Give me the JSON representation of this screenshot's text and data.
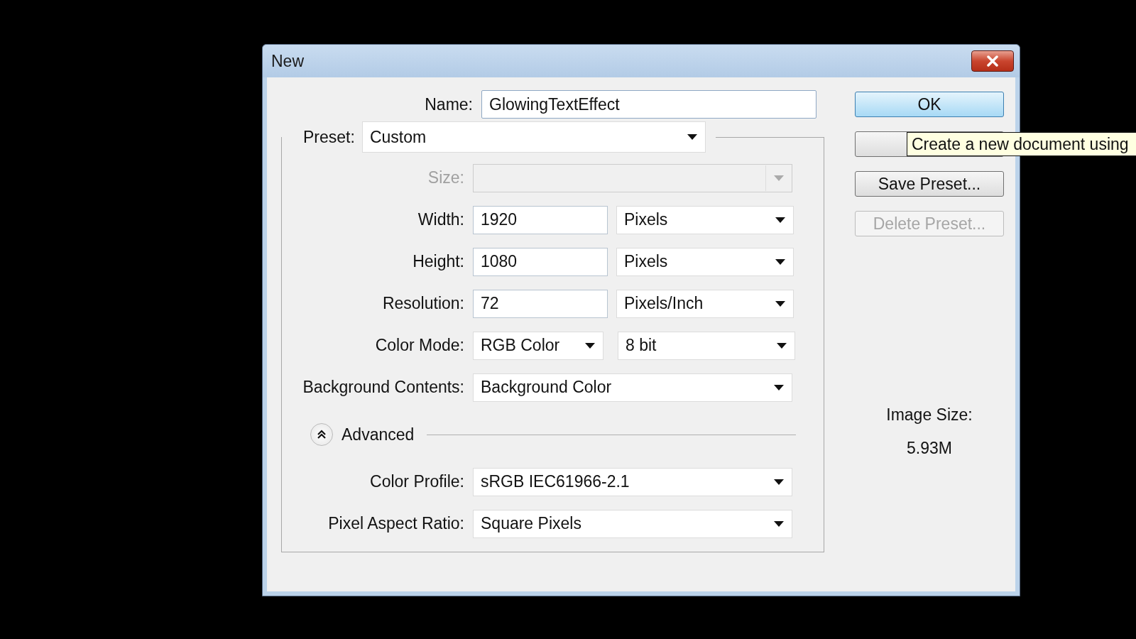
{
  "window": {
    "title": "New"
  },
  "name_field": {
    "label": "Name:",
    "value": "GlowingTextEffect"
  },
  "preset": {
    "label": "Preset:",
    "value": "Custom"
  },
  "rows": [
    {
      "kind": "select",
      "label": "Size:",
      "value": "",
      "disabled": true
    },
    {
      "kind": "number_unit",
      "label": "Width:",
      "value": "1920",
      "unit": "Pixels",
      "disabled": false
    },
    {
      "kind": "number_unit",
      "label": "Height:",
      "value": "1080",
      "unit": "Pixels",
      "disabled": false
    },
    {
      "kind": "number_unit",
      "label": "Resolution:",
      "value": "72",
      "unit": "Pixels/Inch",
      "disabled": false
    },
    {
      "kind": "two_selects",
      "label": "Color Mode:",
      "value": "RGB Color",
      "unit": "8 bit",
      "disabled": false
    },
    {
      "kind": "select",
      "label": "Background Contents:",
      "value": "Background Color",
      "disabled": false
    }
  ],
  "advanced": {
    "label": "Advanced",
    "expanded": true
  },
  "advanced_rows": [
    {
      "kind": "select",
      "label": "Color Profile:",
      "value": "sRGB IEC61966-2.1",
      "disabled": false
    },
    {
      "kind": "select",
      "label": "Pixel Aspect Ratio:",
      "value": "Square Pixels",
      "disabled": false
    }
  ],
  "buttons": [
    {
      "label": "OK",
      "default": true,
      "disabled": false
    },
    {
      "default": false,
      "disabled": false
    },
    {
      "label": "Save Preset...",
      "default": false,
      "disabled": false
    },
    {
      "label": "Delete Preset...",
      "default": false,
      "disabled": true
    }
  ],
  "tooltip": {
    "text": "Create a new document using"
  },
  "image_size": {
    "label": "Image Size:",
    "value": "5.93M"
  }
}
